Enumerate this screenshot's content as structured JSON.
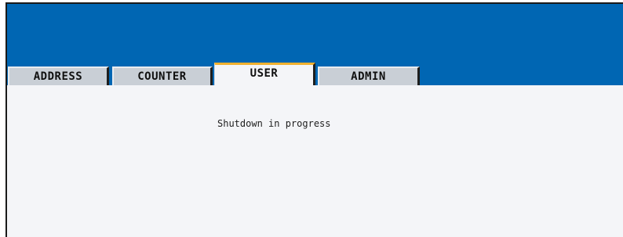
{
  "tabs": [
    {
      "label": "ADDRESS",
      "active": false
    },
    {
      "label": "COUNTER",
      "active": false
    },
    {
      "label": "USER",
      "active": true
    },
    {
      "label": "ADMIN",
      "active": false
    }
  ],
  "main": {
    "status_message": "Shutdown in progress"
  },
  "colors": {
    "header_blue": "#0066b3",
    "active_tab_accent": "#f0b030",
    "panel_background": "#f4f5f8"
  }
}
